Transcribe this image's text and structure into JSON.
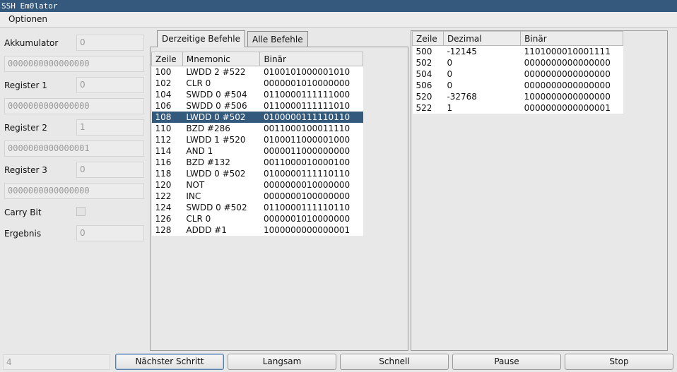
{
  "window": {
    "title": "SSH Em0lator"
  },
  "menu": {
    "options_label": "Optionen"
  },
  "registers": {
    "akku_label": "Akkumulator",
    "akku_value": "0",
    "akku_binary": "0000000000000000",
    "r1_label": "Register 1",
    "r1_value": "0",
    "r1_binary": "0000000000000000",
    "r2_label": "Register 2",
    "r2_value": "1",
    "r2_binary": "0000000000000001",
    "r3_label": "Register 3",
    "r3_value": "0",
    "r3_binary": "0000000000000000",
    "carry_label": "Carry Bit",
    "carry_checked": false,
    "result_label": "Ergebnis",
    "result_value": "0"
  },
  "tabs": {
    "current": "Derzeitige Befehle",
    "all": "Alle Befehle"
  },
  "program": {
    "columns": [
      "Zeile",
      "Mnemonic",
      "Binär"
    ],
    "selected_row": 4,
    "rows": [
      [
        "100",
        "LWDD 2 #522",
        "0100101000001010"
      ],
      [
        "102",
        "CLR 0",
        "0000001010000000"
      ],
      [
        "104",
        "SWDD 0 #504",
        "0110000111111000"
      ],
      [
        "106",
        "SWDD 0 #506",
        "0110000111111010"
      ],
      [
        "108",
        "LWDD 0 #502",
        "0100000111110110"
      ],
      [
        "110",
        "BZD #286",
        "0011000100011110"
      ],
      [
        "112",
        "LWDD 1 #520",
        "0100011000001000"
      ],
      [
        "114",
        "AND 1",
        "0000011000000000"
      ],
      [
        "116",
        "BZD #132",
        "0011000010000100"
      ],
      [
        "118",
        "LWDD 0 #502",
        "0100000111110110"
      ],
      [
        "120",
        "NOT",
        "0000000010000000"
      ],
      [
        "122",
        "INC",
        "0000000100000000"
      ],
      [
        "124",
        "SWDD 0 #502",
        "0110000111110110"
      ],
      [
        "126",
        "CLR 0",
        "0000001010000000"
      ],
      [
        "128",
        "ADDD #1",
        "1000000000000001"
      ]
    ]
  },
  "memory": {
    "columns": [
      "Zeile",
      "Dezimal",
      "Binär"
    ],
    "rows": [
      [
        "500",
        "-12145",
        "1101000010001111"
      ],
      [
        "502",
        "0",
        "0000000000000000"
      ],
      [
        "504",
        "0",
        "0000000000000000"
      ],
      [
        "506",
        "0",
        "0000000000000000"
      ],
      [
        "520",
        "-32768",
        "1000000000000000"
      ],
      [
        "522",
        "1",
        "0000000000000001"
      ]
    ]
  },
  "status": {
    "value": "4"
  },
  "buttons": {
    "next": "Nächster Schritt",
    "slow": "Langsam",
    "fast": "Schnell",
    "pause": "Pause",
    "stop": "Stop"
  }
}
